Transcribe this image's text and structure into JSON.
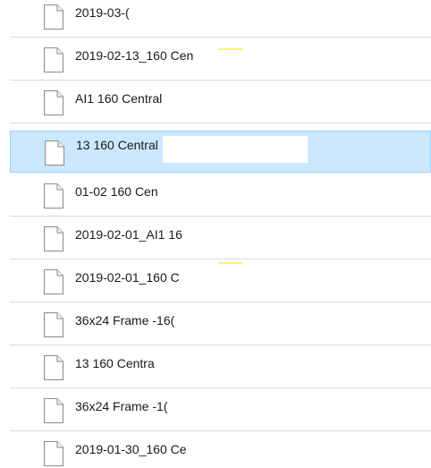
{
  "file_list": {
    "items": [
      {
        "name": "2019-03-(",
        "icon": "file-icon",
        "selected": false
      },
      {
        "name": "2019-02-13_160 Cen",
        "icon": "file-icon",
        "selected": false
      },
      {
        "name": "AI1 160 Central",
        "icon": "file-icon",
        "selected": false
      },
      {
        "name": "13 160 Central",
        "icon": "file-icon",
        "selected": true
      },
      {
        "name": "01-02  160 Cen",
        "icon": "file-icon",
        "selected": false
      },
      {
        "name": "2019-02-01_AI1 16",
        "icon": "file-icon",
        "selected": false
      },
      {
        "name": "2019-02-01_160 C",
        "icon": "file-icon",
        "selected": false
      },
      {
        "name": "36x24 Frame -16(",
        "icon": "file-icon",
        "selected": false
      },
      {
        "name": "13 160 Centra",
        "icon": "file-icon",
        "selected": false
      },
      {
        "name": "36x24 Frame -1(",
        "icon": "file-icon",
        "selected": false
      },
      {
        "name": "2019-01-30_160 Ce",
        "icon": "file-icon",
        "selected": false
      }
    ]
  },
  "colors": {
    "selection_fill": "#cce8ff",
    "selection_border": "#99d1ff",
    "row_divider": "#d9d9d9",
    "text": "#1a1a1a"
  }
}
